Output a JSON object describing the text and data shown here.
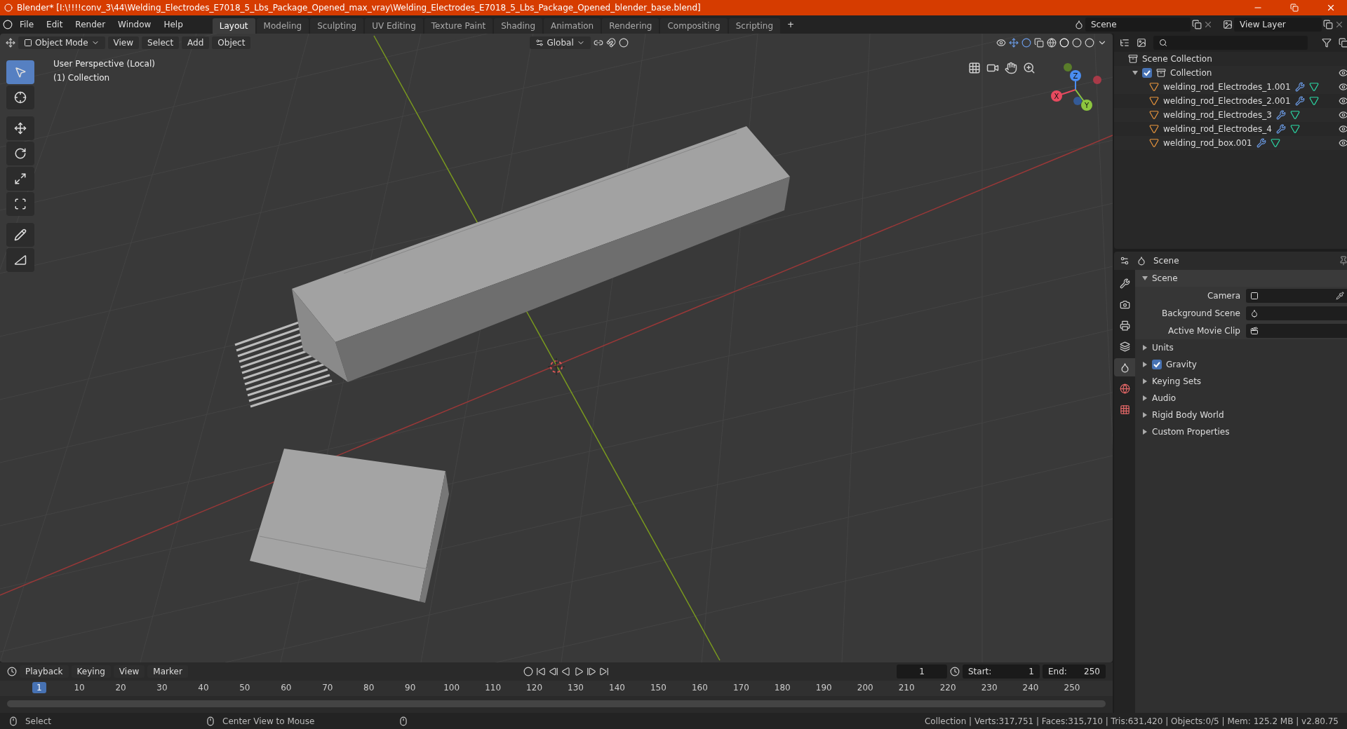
{
  "window": {
    "title": "Blender* [I:\\!!!!conv_3\\44\\Welding_Electrodes_E7018_5_Lbs_Package_Opened_max_vray\\Welding_Electrodes_E7018_5_Lbs_Package_Opened_blender_base.blend]"
  },
  "menu": [
    "File",
    "Edit",
    "Render",
    "Window",
    "Help"
  ],
  "workspaces": [
    {
      "label": "Layout",
      "selected": true
    },
    {
      "label": "Modeling",
      "selected": false
    },
    {
      "label": "Sculpting",
      "selected": false
    },
    {
      "label": "UV Editing",
      "selected": false
    },
    {
      "label": "Texture Paint",
      "selected": false
    },
    {
      "label": "Shading",
      "selected": false
    },
    {
      "label": "Animation",
      "selected": false
    },
    {
      "label": "Rendering",
      "selected": false
    },
    {
      "label": "Compositing",
      "selected": false
    },
    {
      "label": "Scripting",
      "selected": false
    }
  ],
  "add_workspace": "+",
  "scene_field": "Scene",
  "view_layer_field": "View Layer",
  "viewport": {
    "mode": "Object Mode",
    "menus": [
      "View",
      "Select",
      "Add",
      "Object"
    ],
    "orientation": "Global",
    "info": [
      "User Perspective (Local)",
      "(1) Collection"
    ],
    "tools": [
      {
        "kind": "select",
        "selected": true
      },
      {
        "kind": "cursor",
        "selected": false
      },
      {
        "kind": "move",
        "selected": false
      },
      {
        "kind": "rotate",
        "selected": false
      },
      {
        "kind": "scale",
        "selected": false
      },
      {
        "kind": "transform",
        "selected": false
      },
      {
        "kind": "annotate",
        "selected": false
      },
      {
        "kind": "measure",
        "selected": false
      }
    ],
    "gizmo": {
      "x": "X",
      "y": "Y",
      "z": "Z"
    }
  },
  "outliner": {
    "root": "Scene Collection",
    "collection": {
      "name": "Collection",
      "checked": true,
      "expanded": true,
      "children": [
        {
          "name": "welding_rod_Electrodes_1.001"
        },
        {
          "name": "welding_rod_Electrodes_2.001"
        },
        {
          "name": "welding_rod_Electrodes_3"
        },
        {
          "name": "welding_rod_Electrodes_4"
        },
        {
          "name": "welding_rod_box.001"
        }
      ]
    }
  },
  "properties": {
    "context": "Scene",
    "tabs": [
      {
        "kind": "tool",
        "selected": false
      },
      {
        "kind": "render",
        "selected": false
      },
      {
        "kind": "output",
        "selected": false
      },
      {
        "kind": "view_layer",
        "selected": false
      },
      {
        "kind": "scene",
        "selected": true
      },
      {
        "kind": "world",
        "selected": false
      },
      {
        "kind": "texture",
        "selected": false
      }
    ],
    "panels": [
      {
        "title": "Scene",
        "expanded": true,
        "fields": [
          {
            "label": "Camera",
            "kind": "camera"
          },
          {
            "label": "Background Scene",
            "kind": "scene"
          },
          {
            "label": "Active Movie Clip",
            "kind": "clip"
          }
        ]
      },
      {
        "title": "Units",
        "expanded": false
      },
      {
        "title": "Gravity",
        "expanded": false,
        "checked": true
      },
      {
        "title": "Keying Sets",
        "expanded": false
      },
      {
        "title": "Audio",
        "expanded": false
      },
      {
        "title": "Rigid Body World",
        "expanded": false
      },
      {
        "title": "Custom Properties",
        "expanded": false
      }
    ]
  },
  "timeline": {
    "menus": [
      "Playback",
      "Keying",
      "View",
      "Marker"
    ],
    "current_frame": "1",
    "start_label": "Start:",
    "start": "1",
    "end_label": "End:",
    "end": "250",
    "playhead": "1",
    "ruler": [
      "10",
      "20",
      "30",
      "40",
      "50",
      "60",
      "70",
      "80",
      "90",
      "100",
      "110",
      "120",
      "130",
      "140",
      "150",
      "160",
      "170",
      "180",
      "190",
      "200",
      "210",
      "220",
      "230",
      "240",
      "250"
    ]
  },
  "status_bar": {
    "left": "Select",
    "middle": "Center View to Mouse",
    "stats": "Collection | Verts:317,751 | Faces:315,710 | Tris:631,420 | Objects:0/5 | Mem: 125.2 MB | v2.80.75"
  }
}
